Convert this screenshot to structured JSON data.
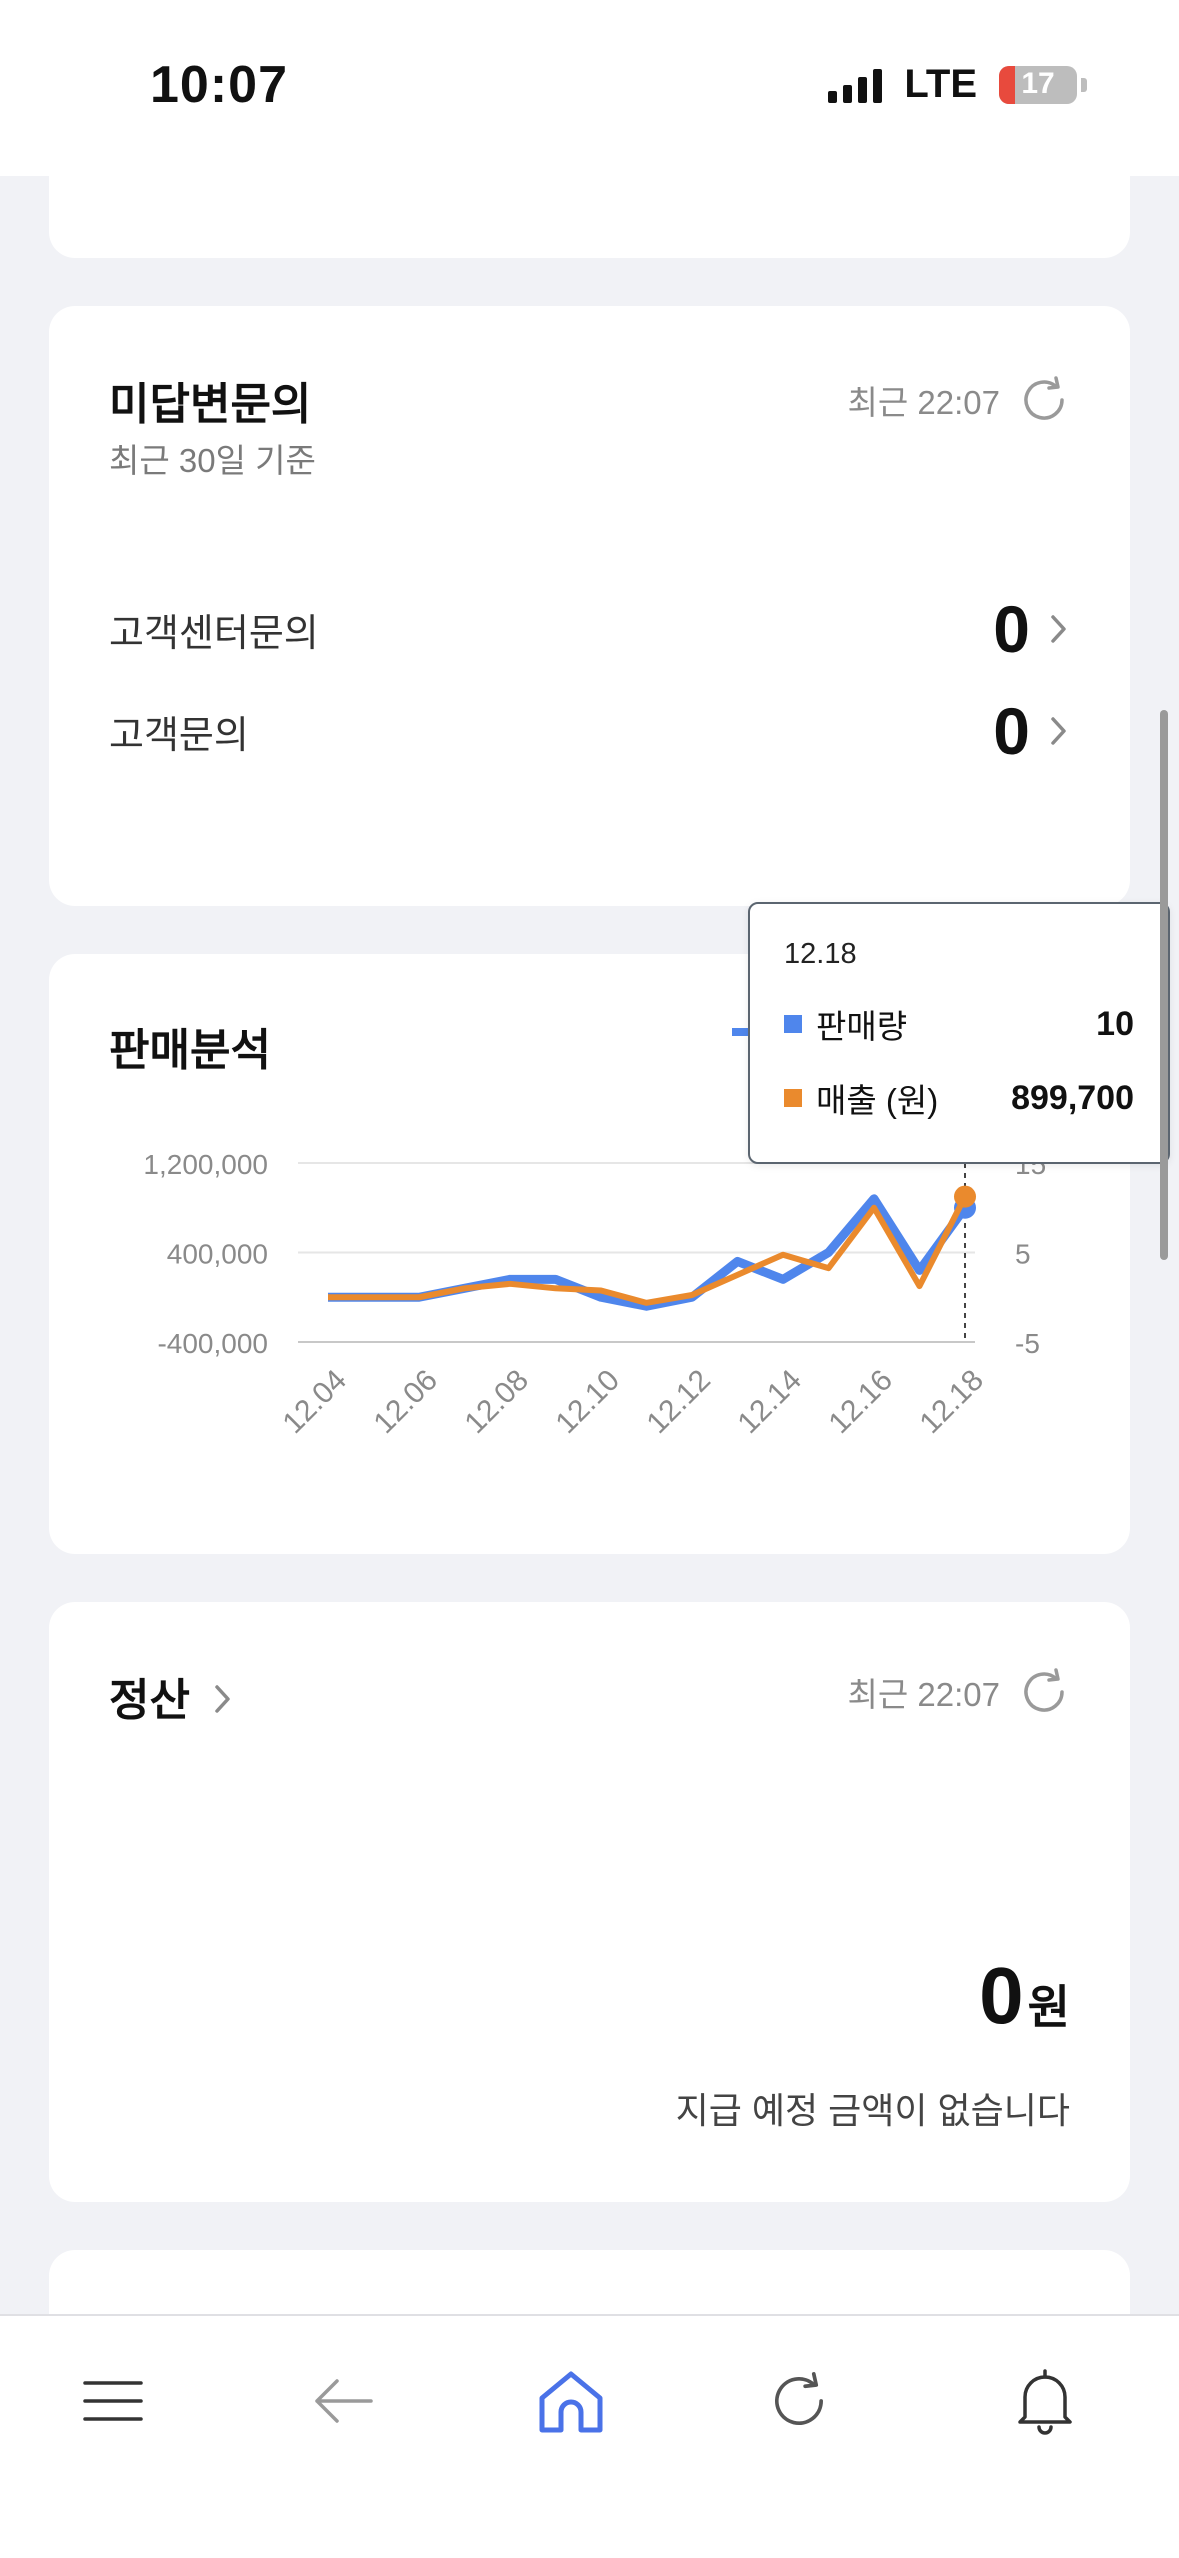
{
  "status": {
    "time": "10:07",
    "network": "LTE",
    "battery": "17"
  },
  "colors": {
    "series_sales": "#4f86ec",
    "series_revenue": "#ea8a2d",
    "accent": "#4a72e8"
  },
  "inquiries": {
    "title": "미답변문의",
    "subtitle": "최근 30일 기준",
    "updated": "최근 22:07",
    "rows": [
      {
        "label": "고객센터문의",
        "count": "0"
      },
      {
        "label": "고객문의",
        "count": "0"
      }
    ]
  },
  "sales": {
    "title": "판매분석",
    "tooltip": {
      "date": "12.18",
      "rows": [
        {
          "label": "판매량",
          "value": "10"
        },
        {
          "label": "매출 (원)",
          "value": "899,700"
        }
      ]
    }
  },
  "chart_data": {
    "type": "line",
    "x": [
      "12.04",
      "12.05",
      "12.06",
      "12.07",
      "12.08",
      "12.09",
      "12.10",
      "12.11",
      "12.12",
      "12.13",
      "12.14",
      "12.15",
      "12.16",
      "12.17",
      "12.18"
    ],
    "x_tick_labels": [
      "12.04",
      "12.06",
      "12.08",
      "12.10",
      "12.12",
      "12.14",
      "12.16",
      "12.18"
    ],
    "y_left_ticks": [
      "1,200,000",
      "400,000",
      "-400,000"
    ],
    "y_left_range": [
      -400000,
      1200000
    ],
    "y_right_ticks": [
      "15",
      "5",
      "-5"
    ],
    "y_right_range": [
      -5,
      15
    ],
    "series": [
      {
        "name": "판매량",
        "axis": "right",
        "values": [
          0,
          0,
          0,
          1,
          2,
          2,
          0,
          -1,
          0,
          4,
          2,
          5,
          11,
          3,
          10
        ]
      },
      {
        "name": "매출 (원)",
        "axis": "left",
        "values": [
          0,
          0,
          0,
          80000,
          120000,
          80000,
          60000,
          -50000,
          20000,
          200000,
          380000,
          260000,
          800000,
          100000,
          899700
        ]
      }
    ],
    "highlight_x": "12.18",
    "grid": "horizontal"
  },
  "settlement": {
    "title": "정산",
    "updated": "최근 22:07",
    "amount": "0",
    "unit": "원",
    "message": "지급 예정 금액이 없습니다"
  },
  "nav": [
    {
      "icon": "menu-icon"
    },
    {
      "icon": "back-arrow-icon"
    },
    {
      "icon": "home-icon"
    },
    {
      "icon": "refresh-icon"
    },
    {
      "icon": "bell-icon"
    }
  ]
}
